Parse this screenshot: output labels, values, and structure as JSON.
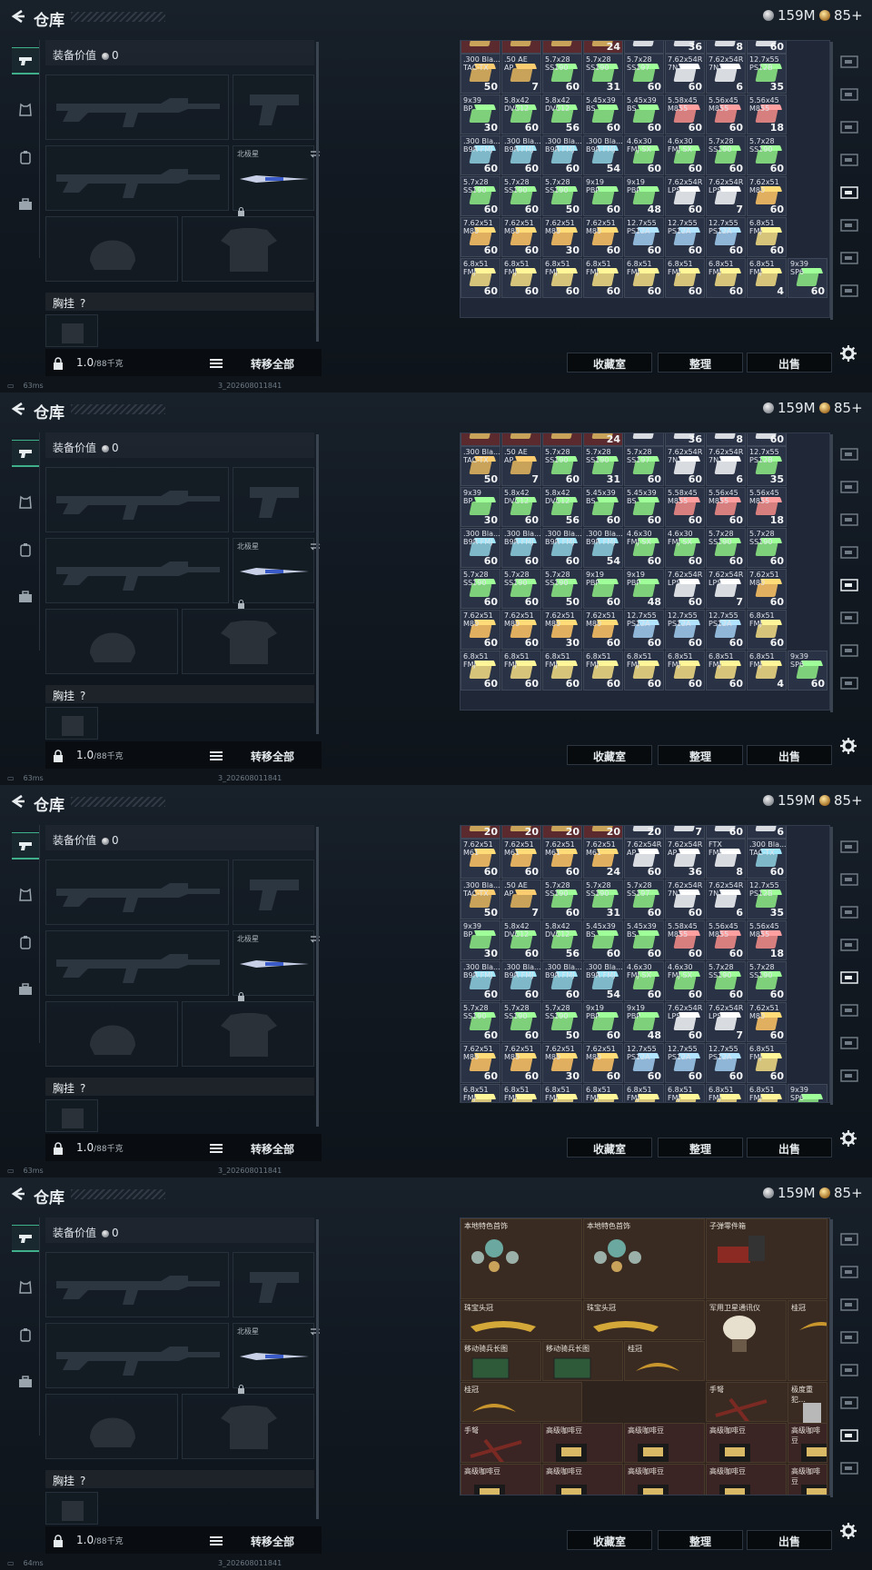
{
  "header": {
    "title": "仓库",
    "silver_value": "159M",
    "gold_value": "85+"
  },
  "left_nav": {
    "items": [
      "pistol",
      "armor",
      "backpack",
      "briefcase"
    ]
  },
  "equip": {
    "value_label": "装备价值",
    "value_amount": "0",
    "melee_name": "北极星",
    "chest_label": "胸挂",
    "chest_help": "?",
    "weight_value": "1.0",
    "weight_max": "/88千克",
    "transfer_all": "转移全部"
  },
  "actions": {
    "collection": "收藏室",
    "sort": "整理",
    "sell": "出售"
  },
  "status": {
    "ping_a": "63ms",
    "ping_b": "64ms",
    "build": "3_202608011841"
  },
  "ammo_frames": [
    {
      "top_partial_counts": [
        "",
        "",
        "",
        "24",
        "",
        "36",
        "8",
        "60"
      ],
      "rows": [
        [
          [
            ".300 Bla...\nTAC-TX",
            "50",
            "#c9a35a"
          ],
          [
            ".50 AE\nAP",
            "7",
            "#c9a35a"
          ],
          [
            "5.7x28\nSS190",
            "60",
            "#7fd07a"
          ],
          [
            "5.7x28\nSS190",
            "31",
            "#7fd07a"
          ],
          [
            "5.7x28\nSS197",
            "60",
            "#7fd07a"
          ],
          [
            "7.62x54R\n7N1",
            "60",
            "#d8dbe0"
          ],
          [
            "7.62x54R\n7N1",
            "6",
            "#d8dbe0"
          ],
          [
            "12.7x55\nPS12B",
            "35",
            "#7fd07a"
          ]
        ],
        [
          [
            "9x39\nBP",
            "30",
            "#7fd07a"
          ],
          [
            "5.8x42\nDVC12",
            "60",
            "#7fd07a"
          ],
          [
            "5.8x42\nDVC12",
            "56",
            "#7fd07a"
          ],
          [
            "5.45x39\nBS",
            "60",
            "#7fd07a"
          ],
          [
            "5.45x39\nBS",
            "60",
            "#7fd07a"
          ],
          [
            "5.58x45\nM855",
            "60",
            "#d77f7f"
          ],
          [
            "5.56x45\nM855",
            "60",
            "#d77f7f"
          ],
          [
            "5.56x45\nM855",
            "18",
            "#d77f7f"
          ]
        ],
        [
          [
            ".300 Bla...\nB9R FMJ",
            "60",
            "#7fb8c9"
          ],
          [
            ".300 Bla...\nB9R FMJ",
            "60",
            "#7fb8c9"
          ],
          [
            ".300 Bla...\nB9R FMJ",
            "60",
            "#7fb8c9"
          ],
          [
            ".300 Bla...\nB9R FMJ",
            "54",
            "#7fb8c9"
          ],
          [
            "4.6x30\nFMJ SX",
            "60",
            "#7fd07a"
          ],
          [
            "4.6x30\nFMJ SX",
            "60",
            "#7fd07a"
          ],
          [
            "5.7x28\nSS190",
            "60",
            "#7fd07a"
          ],
          [
            "5.7x28\nSS190",
            "60",
            "#7fd07a"
          ]
        ],
        [
          [
            "5.7x28\nSS190",
            "60",
            "#7fd07a"
          ],
          [
            "5.7x28\nSS190",
            "60",
            "#7fd07a"
          ],
          [
            "5.7x28\nSS190",
            "50",
            "#7fd07a"
          ],
          [
            "9x19\nPBP",
            "60",
            "#7fd07a"
          ],
          [
            "9x19\nPBP",
            "48",
            "#7fd07a"
          ],
          [
            "7.62x54R\nLPS",
            "60",
            "#d8dbe0"
          ],
          [
            "7.62x54R\nLPS",
            "7",
            "#d8dbe0"
          ],
          [
            "7.62x51\nM80",
            "60",
            "#e0b060"
          ]
        ],
        [
          [
            "7.62x51\nM80",
            "60",
            "#e0b060"
          ],
          [
            "7.62x51\nM80",
            "60",
            "#e0b060"
          ],
          [
            "7.62x51\nM80",
            "30",
            "#e0b060"
          ],
          [
            "7.62x51\nM80",
            "60",
            "#e0b060"
          ],
          [
            "12.7x55\nPS12A",
            "60",
            "#8fb6d6"
          ],
          [
            "12.7x55\nPS12A",
            "60",
            "#8fb6d6"
          ],
          [
            "12.7x55\nPS12A",
            "60",
            "#8fb6d6"
          ],
          [
            "6.8x51\nFMJ",
            "60",
            "#d6c47a"
          ]
        ],
        [
          [
            "6.8x51\nFMJ",
            "60",
            "#d6c47a"
          ],
          [
            "6.8x51\nFMJ",
            "60",
            "#d6c47a"
          ],
          [
            "6.8x51\nFMJ",
            "60",
            "#d6c47a"
          ],
          [
            "6.8x51\nFMJ",
            "60",
            "#d6c47a"
          ],
          [
            "6.8x51\nFMJ",
            "60",
            "#d6c47a"
          ],
          [
            "6.8x51\nFMJ",
            "60",
            "#d6c47a"
          ],
          [
            "6.8x51\nFMJ",
            "60",
            "#d6c47a"
          ],
          [
            "6.8x51\nFMJ",
            "4",
            "#d6c47a"
          ],
          [
            "9x39\nSP6",
            "60",
            "#7fd07a"
          ]
        ]
      ]
    }
  ],
  "frame3_top_counts": [
    "20",
    "20",
    "20",
    "20",
    "20",
    "7",
    "60",
    "6"
  ],
  "frame3_extra_row": [
    [
      "7.62x51\nM61",
      "60",
      "#e0b060"
    ],
    [
      "7.62x51\nM61",
      "60",
      "#e0b060"
    ],
    [
      "7.62x51\nM61",
      "60",
      "#e0b060"
    ],
    [
      "7.62x51\nM61",
      "24",
      "#e0b060"
    ],
    [
      "7.62x54R\nAP",
      "60",
      "#d8dbe0"
    ],
    [
      "7.62x54R\nAP",
      "36",
      "#d8dbe0"
    ],
    [
      "FTX\nFMJ",
      "8",
      "#d8dbe0"
    ],
    [
      ".300 Bla...\nTAC-TX",
      "60",
      "#7fb8c9"
    ]
  ],
  "loot": {
    "items": [
      {
        "name": "本地特色首饰"
      },
      {
        "name": "本地特色首饰"
      },
      {
        "name": "子弹零件箱"
      },
      {
        "name": "珠宝头冠"
      },
      {
        "name": "珠宝头冠"
      },
      {
        "name": "军用卫星通讯仪"
      },
      {
        "name": "桂冠"
      },
      {
        "name": "移动骑兵长图"
      },
      {
        "name": "移动骑兵长图"
      },
      {
        "name": "桂冠"
      },
      {
        "name": "桂冠"
      },
      {
        "name": "手弩"
      },
      {
        "name": "极度重犯…"
      },
      {
        "name": "手弩"
      },
      {
        "name": "高级咖啡豆"
      },
      {
        "name": "高级咖啡豆"
      },
      {
        "name": "高级咖啡豆"
      },
      {
        "name": "高级咖啡豆"
      },
      {
        "name": "高级咖啡豆"
      },
      {
        "name": "高级咖啡豆"
      },
      {
        "name": "高级咖啡豆"
      },
      {
        "name": "高级咖啡豆"
      },
      {
        "name": "高级咖啡豆"
      },
      {
        "name": "高级咖啡豆"
      }
    ]
  },
  "colors": {
    "accent": "#3fb08a",
    "panel": "#202737",
    "loot_bg": "#3a2b22"
  }
}
